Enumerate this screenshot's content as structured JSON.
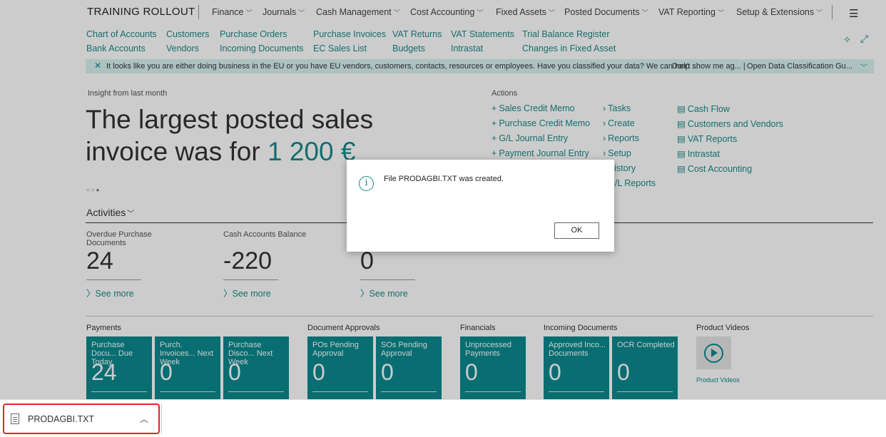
{
  "app": {
    "title": "TRAINING ROLLOUT"
  },
  "nav": {
    "items": [
      "Finance",
      "Journals",
      "Cash Management",
      "Cost Accounting",
      "Fixed Assets",
      "Posted Documents",
      "VAT Reporting",
      "Setup & Extensions"
    ]
  },
  "links": {
    "row1": [
      "Chart of Accounts",
      "Customers",
      "Purchase Orders",
      "Purchase Invoices",
      "VAT Returns",
      "VAT Statements",
      "Trial Balance Register"
    ],
    "row2": [
      "Bank Accounts",
      "Vendors",
      "Incoming Documents",
      "EC Sales List",
      "Budgets",
      "Intrastat",
      "Changes in Fixed Asset"
    ]
  },
  "banner": {
    "message": "It looks like you are either doing business in the EU or you have EU vendors, customers, contacts, resources or employees. Have you classified your data? We can help ...",
    "action1": "Don't show me ag... |",
    "action2": "Open Data Classification Gu..."
  },
  "insight": {
    "label": "Insight from last month",
    "line1": "The largest posted sales",
    "line2": "invoice was for",
    "value": "1 200 €"
  },
  "actions": {
    "label": "Actions",
    "col1": [
      "Sales Credit Memo",
      "Purchase Credit Memo",
      "G/L Journal Entry",
      "Payment Journal Entry"
    ],
    "col2": [
      "Tasks",
      "Create",
      "Reports",
      "Setup",
      "History",
      "G/L Reports"
    ],
    "col3": [
      "Cash Flow",
      "Customers and Vendors",
      "VAT Reports",
      "Intrastat",
      "Cost Accounting"
    ]
  },
  "activities": {
    "title": "Activities",
    "cues": [
      {
        "label": "Overdue Purchase Documents",
        "value": "24",
        "link": "See more"
      },
      {
        "label": "Cash Accounts Balance",
        "value": "-220",
        "link": "See more"
      },
      {
        "label": "",
        "value": "0",
        "link": "See more"
      }
    ]
  },
  "tiles": {
    "groups": [
      "Payments",
      "Document Approvals",
      "Financials",
      "Incoming Documents",
      "Product Videos"
    ],
    "items": [
      {
        "title": "Purchase Docu... Due Today",
        "value": "24"
      },
      {
        "title": "Purch. Invoices... Next Week",
        "value": "0"
      },
      {
        "title": "Purchase Disco... Next Week",
        "value": "0"
      },
      {
        "title": "POs Pending Approval",
        "value": "0"
      },
      {
        "title": "SOs Pending Approval",
        "value": "0"
      },
      {
        "title": "Unprocessed Payments",
        "value": "0"
      },
      {
        "title": "Approved Inco... Documents",
        "value": "0"
      },
      {
        "title": "OCR Completed",
        "value": "0"
      }
    ],
    "video_label": "Product Videos"
  },
  "dialog": {
    "message": "File PRODAGBI.TXT was created.",
    "ok": "OK"
  },
  "download": {
    "filename": "PRODAGBI.TXT"
  },
  "colors": {
    "accent": "#0a8a8f",
    "link": "#1a8a8a",
    "highlight": "#e02424"
  }
}
